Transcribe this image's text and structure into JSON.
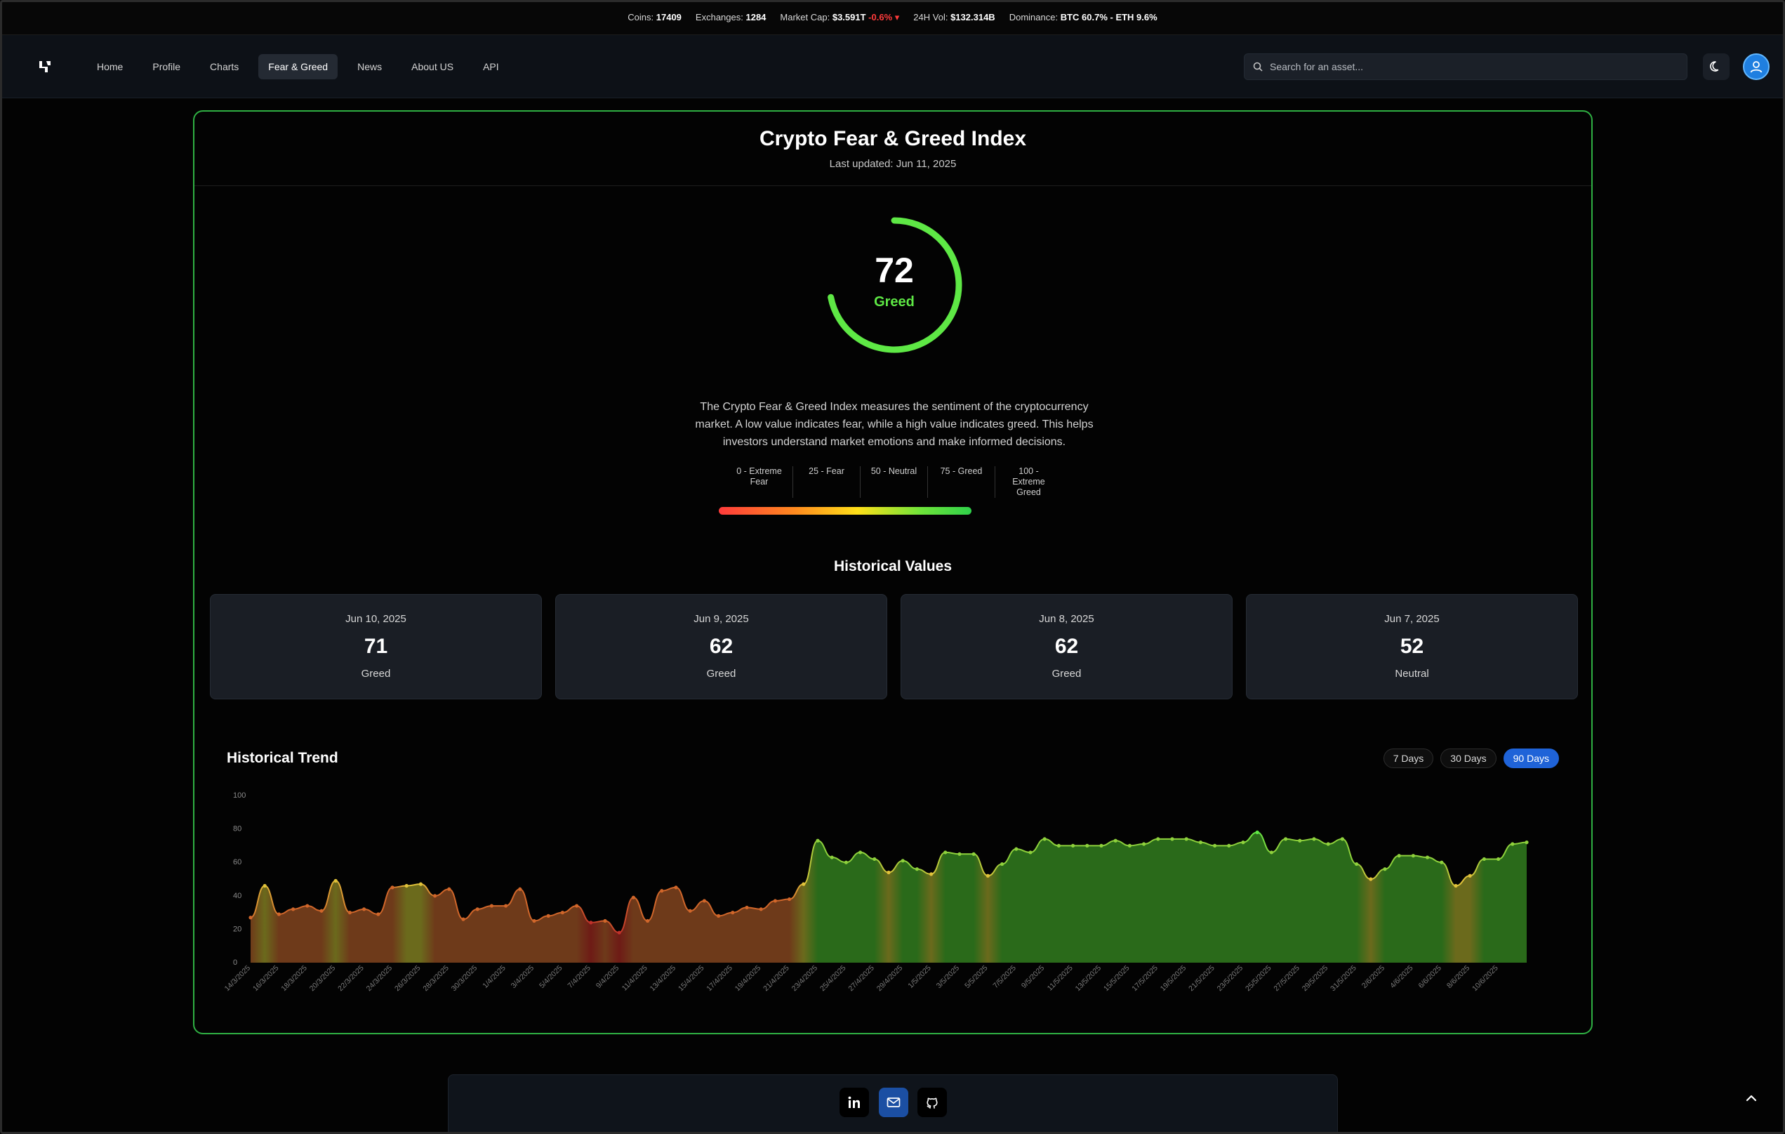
{
  "ticker": {
    "coins_label": "Coins:",
    "coins": "17409",
    "exchanges_label": "Exchanges:",
    "exchanges": "1284",
    "mcap_label": "Market Cap:",
    "mcap": "$3.591T",
    "mcap_change": "-0.6%",
    "vol_label": "24H Vol:",
    "vol": "$132.314B",
    "dom_label": "Dominance:",
    "dom": "BTC 60.7% - ETH 9.6%"
  },
  "nav": {
    "items": [
      "Home",
      "Profile",
      "Charts",
      "Fear & Greed",
      "News",
      "About US",
      "API"
    ],
    "active_index": 3,
    "search_placeholder": "Search for an asset..."
  },
  "page": {
    "title": "Crypto Fear & Greed Index",
    "updated": "Last updated: Jun 11, 2025",
    "gauge": {
      "value": "72",
      "label": "Greed",
      "level": 72,
      "color": "#5ee845"
    },
    "description": "The Crypto Fear & Greed Index measures the sentiment of the cryptocurrency market. A low value indicates fear, while a high value indicates greed. This helps investors understand market emotions and make informed decisions.",
    "scale": [
      "0 - Extreme Fear",
      "25 - Fear",
      "50 - Neutral",
      "75 - Greed",
      "100 - Extreme Greed"
    ],
    "historical_title": "Historical Values",
    "historical": [
      {
        "date": "Jun 10, 2025",
        "value": "71",
        "class": "Greed"
      },
      {
        "date": "Jun 9, 2025",
        "value": "62",
        "class": "Greed"
      },
      {
        "date": "Jun 8, 2025",
        "value": "62",
        "class": "Greed"
      },
      {
        "date": "Jun 7, 2025",
        "value": "52",
        "class": "Neutral"
      }
    ],
    "trend_title": "Historical Trend",
    "ranges": [
      "7 Days",
      "30 Days",
      "90 Days"
    ],
    "active_range": 2
  },
  "chart_data": {
    "type": "area",
    "title": "Historical Trend",
    "ylim": [
      0,
      100
    ],
    "yticks": [
      0,
      20,
      40,
      60,
      80,
      100
    ],
    "grid": false,
    "x": [
      "14/3/2025",
      "15/3/2025",
      "16/3/2025",
      "17/3/2025",
      "18/3/2025",
      "19/3/2025",
      "20/3/2025",
      "21/3/2025",
      "22/3/2025",
      "23/3/2025",
      "24/3/2025",
      "25/3/2025",
      "26/3/2025",
      "27/3/2025",
      "28/3/2025",
      "29/3/2025",
      "30/3/2025",
      "31/3/2025",
      "1/4/2025",
      "2/4/2025",
      "3/4/2025",
      "4/4/2025",
      "5/4/2025",
      "6/4/2025",
      "7/4/2025",
      "8/4/2025",
      "9/4/2025",
      "10/4/2025",
      "11/4/2025",
      "12/4/2025",
      "13/4/2025",
      "14/4/2025",
      "15/4/2025",
      "16/4/2025",
      "17/4/2025",
      "18/4/2025",
      "19/4/2025",
      "20/4/2025",
      "21/4/2025",
      "22/4/2025",
      "23/4/2025",
      "24/4/2025",
      "25/4/2025",
      "26/4/2025",
      "27/4/2025",
      "28/4/2025",
      "29/4/2025",
      "30/4/2025",
      "1/5/2025",
      "2/5/2025",
      "3/5/2025",
      "4/5/2025",
      "5/5/2025",
      "6/5/2025",
      "7/5/2025",
      "8/5/2025",
      "9/5/2025",
      "10/5/2025",
      "11/5/2025",
      "12/5/2025",
      "13/5/2025",
      "14/5/2025",
      "15/5/2025",
      "16/5/2025",
      "17/5/2025",
      "18/5/2025",
      "19/5/2025",
      "20/5/2025",
      "21/5/2025",
      "22/5/2025",
      "23/5/2025",
      "24/5/2025",
      "25/5/2025",
      "26/5/2025",
      "27/5/2025",
      "28/5/2025",
      "29/5/2025",
      "30/5/2025",
      "31/5/2025",
      "1/6/2025",
      "2/6/2025",
      "3/6/2025",
      "4/6/2025",
      "5/6/2025",
      "6/6/2025",
      "7/6/2025",
      "8/6/2025",
      "9/6/2025",
      "10/6/2025"
    ],
    "tick_labels": [
      "14/3/2025",
      "16/3/2025",
      "18/3/2025",
      "20/3/2025",
      "22/3/2025",
      "24/3/2025",
      "26/3/2025",
      "28/3/2025",
      "30/3/2025",
      "1/4/2025",
      "3/4/2025",
      "5/4/2025",
      "7/4/2025",
      "9/4/2025",
      "11/4/2025",
      "13/4/2025",
      "15/4/2025",
      "17/4/2025",
      "19/4/2025",
      "21/4/2025",
      "23/4/2025",
      "25/4/2025",
      "27/4/2025",
      "29/4/2025",
      "1/5/2025",
      "3/5/2025",
      "5/5/2025",
      "7/5/2025",
      "9/5/2025",
      "11/5/2025",
      "13/5/2025",
      "15/5/2025",
      "17/5/2025",
      "19/5/2025",
      "21/5/2025",
      "23/5/2025",
      "25/5/2025",
      "27/5/2025",
      "29/5/2025",
      "31/5/2025",
      "2/6/2025",
      "4/6/2025",
      "6/6/2025",
      "8/6/2025",
      "10/6/2025"
    ],
    "series": [
      {
        "values": [
          27,
          46,
          29,
          32,
          34,
          31,
          49,
          30,
          32,
          29,
          45,
          46,
          47,
          40,
          44,
          26,
          32,
          34,
          34,
          44,
          25,
          28,
          30,
          34,
          24,
          25,
          18,
          39,
          25,
          43,
          45,
          31,
          37,
          28,
          30,
          33,
          32,
          37,
          38,
          47,
          73,
          63,
          60,
          66,
          62,
          54,
          61,
          56,
          53,
          66,
          65,
          65,
          52,
          59,
          68,
          66,
          74,
          70,
          70,
          70,
          70,
          73,
          70,
          71,
          74,
          74,
          74,
          72,
          70,
          70,
          72,
          78,
          66,
          74,
          73,
          74,
          71,
          74,
          59,
          50,
          56,
          64,
          64,
          63,
          60,
          46,
          52,
          62,
          62,
          71,
          72
        ]
      }
    ]
  },
  "footer": {
    "icons": [
      "linkedin-icon",
      "mail-icon",
      "github-icon"
    ]
  }
}
